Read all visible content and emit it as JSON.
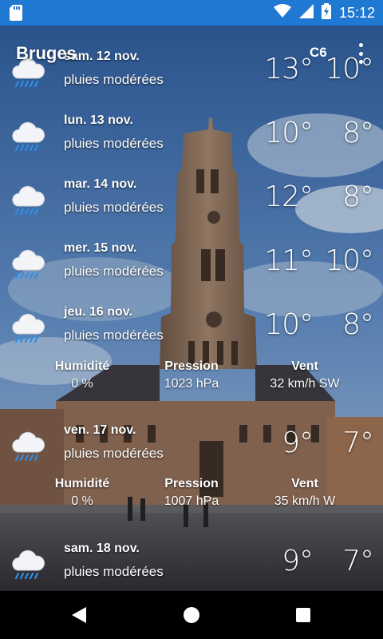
{
  "status_bar": {
    "time": "15:12",
    "left_icon": "sd-card-icon",
    "icons": [
      "wifi-icon",
      "signal-icon",
      "battery-charging-icon"
    ]
  },
  "app": {
    "title": "Bruges",
    "badge": "C6",
    "menu_icon": "more-vert-icon"
  },
  "forecast": [
    {
      "day": "sam. 12 nov.",
      "desc": "pluies modérées",
      "hi": "13°",
      "lo": "10°",
      "icon": "rain-cloud-icon"
    },
    {
      "day": "lun. 13 nov.",
      "desc": "pluies modérées",
      "hi": "10°",
      "lo": "8°",
      "icon": "rain-cloud-icon"
    },
    {
      "day": "mar. 14 nov.",
      "desc": "pluies modérées",
      "hi": "12°",
      "lo": "8°",
      "icon": "rain-cloud-icon"
    },
    {
      "day": "mer. 15 nov.",
      "desc": "pluies modérées",
      "hi": "11°",
      "lo": "10°",
      "icon": "rain-cloud-icon"
    },
    {
      "day": "jeu. 16 nov.",
      "desc": "pluies modérées",
      "hi": "10°",
      "lo": "8°",
      "icon": "rain-cloud-icon"
    },
    {
      "day": "ven. 17 nov.",
      "desc": "pluies modérées",
      "hi": "9°",
      "lo": "7°",
      "icon": "rain-cloud-icon"
    },
    {
      "day": "sam. 18 nov.",
      "desc": "pluies modérées",
      "hi": "9°",
      "lo": "7°",
      "icon": "rain-cloud-icon"
    }
  ],
  "details": [
    {
      "humidity_label": "Humidité",
      "humidity": "0 %",
      "pressure_label": "Pression",
      "pressure": "1023 hPa",
      "wind_label": "Vent",
      "wind": "32 km/h SW"
    },
    {
      "humidity_label": "Humidité",
      "humidity": "0 %",
      "pressure_label": "Pression",
      "pressure": "1007 hPa",
      "wind_label": "Vent",
      "wind": "35 km/h W"
    }
  ],
  "colors": {
    "status_bar": "#1f78d1",
    "sky_top": "#3e6aa8",
    "sky_bottom": "#8fb4d8",
    "tower": "#8a6f5a"
  },
  "nav": {
    "back_icon": "back-triangle-icon",
    "home_icon": "home-circle-icon",
    "recent_icon": "recent-square-icon"
  }
}
